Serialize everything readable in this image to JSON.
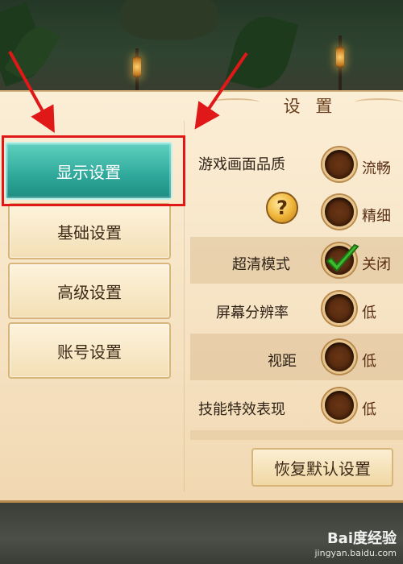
{
  "panel": {
    "title": "设 置"
  },
  "tabs": [
    {
      "label": "显示设置",
      "active": true
    },
    {
      "label": "基础设置",
      "active": false
    },
    {
      "label": "高级设置",
      "active": false
    },
    {
      "label": "账号设置",
      "active": false
    }
  ],
  "settings": [
    {
      "label": "游戏画面品质",
      "option": "流畅"
    },
    {
      "label": "",
      "option": "精细"
    },
    {
      "label": "超清模式",
      "option": "关闭",
      "checked": true
    },
    {
      "label": "屏幕分辨率",
      "option": "低"
    },
    {
      "label": "视距",
      "option": "低"
    },
    {
      "label": "技能特效表现",
      "option": "低"
    }
  ],
  "help_icon": "?",
  "reset_button": "恢复默认设置",
  "watermark": {
    "brand": "Bai度经验",
    "url": "jingyan.baidu.com"
  },
  "colors": {
    "active_tab": "#2ea89a",
    "highlight": "#e01818",
    "panel_bg": "#f6e2c2"
  }
}
